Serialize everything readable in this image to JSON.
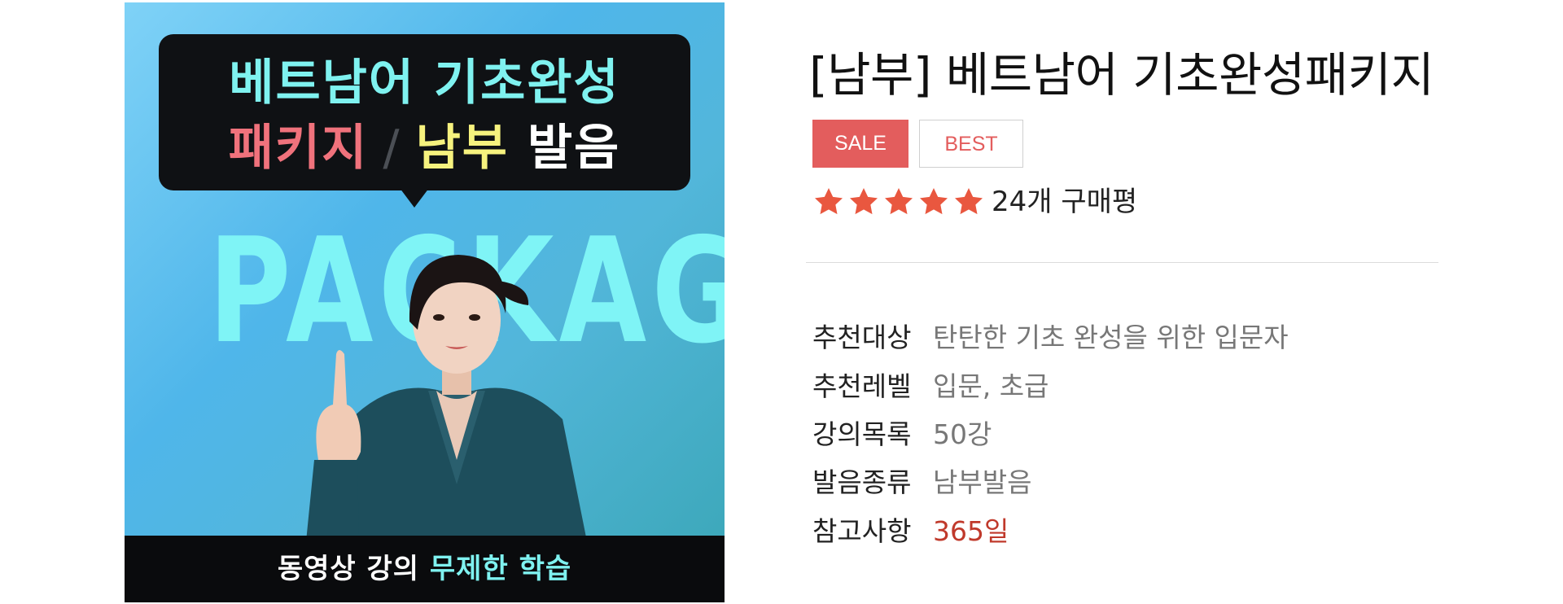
{
  "product_image": {
    "bubble_line1": "베트남어 기초완성",
    "bubble_line2_pink": "패키지",
    "bubble_line2_slash": "/",
    "bubble_line2_yellow": "남부",
    "bubble_line2_white": "발음",
    "background_word": "PACKAGE",
    "banner_white": "동영상 강의 ",
    "banner_cyan": "무제한 학습"
  },
  "product": {
    "title": "[남부] 베트남어 기초완성패키지",
    "badges": {
      "sale": "SALE",
      "best": "BEST"
    },
    "rating": {
      "stars": 5,
      "review_text": "24개 구매평"
    },
    "specs": [
      {
        "label": "추천대상",
        "value": "탄탄한 기초 완성을 위한 입문자"
      },
      {
        "label": "추천레벨",
        "value": "입문, 초급"
      },
      {
        "label": "강의목록",
        "value": "50강"
      },
      {
        "label": "발음종류",
        "value": "남부발음"
      },
      {
        "label": "참고사항",
        "value": "365일"
      }
    ]
  },
  "colors": {
    "accent": "#e35d5d",
    "star": "#e9573f",
    "note_value": "#c0392b"
  }
}
